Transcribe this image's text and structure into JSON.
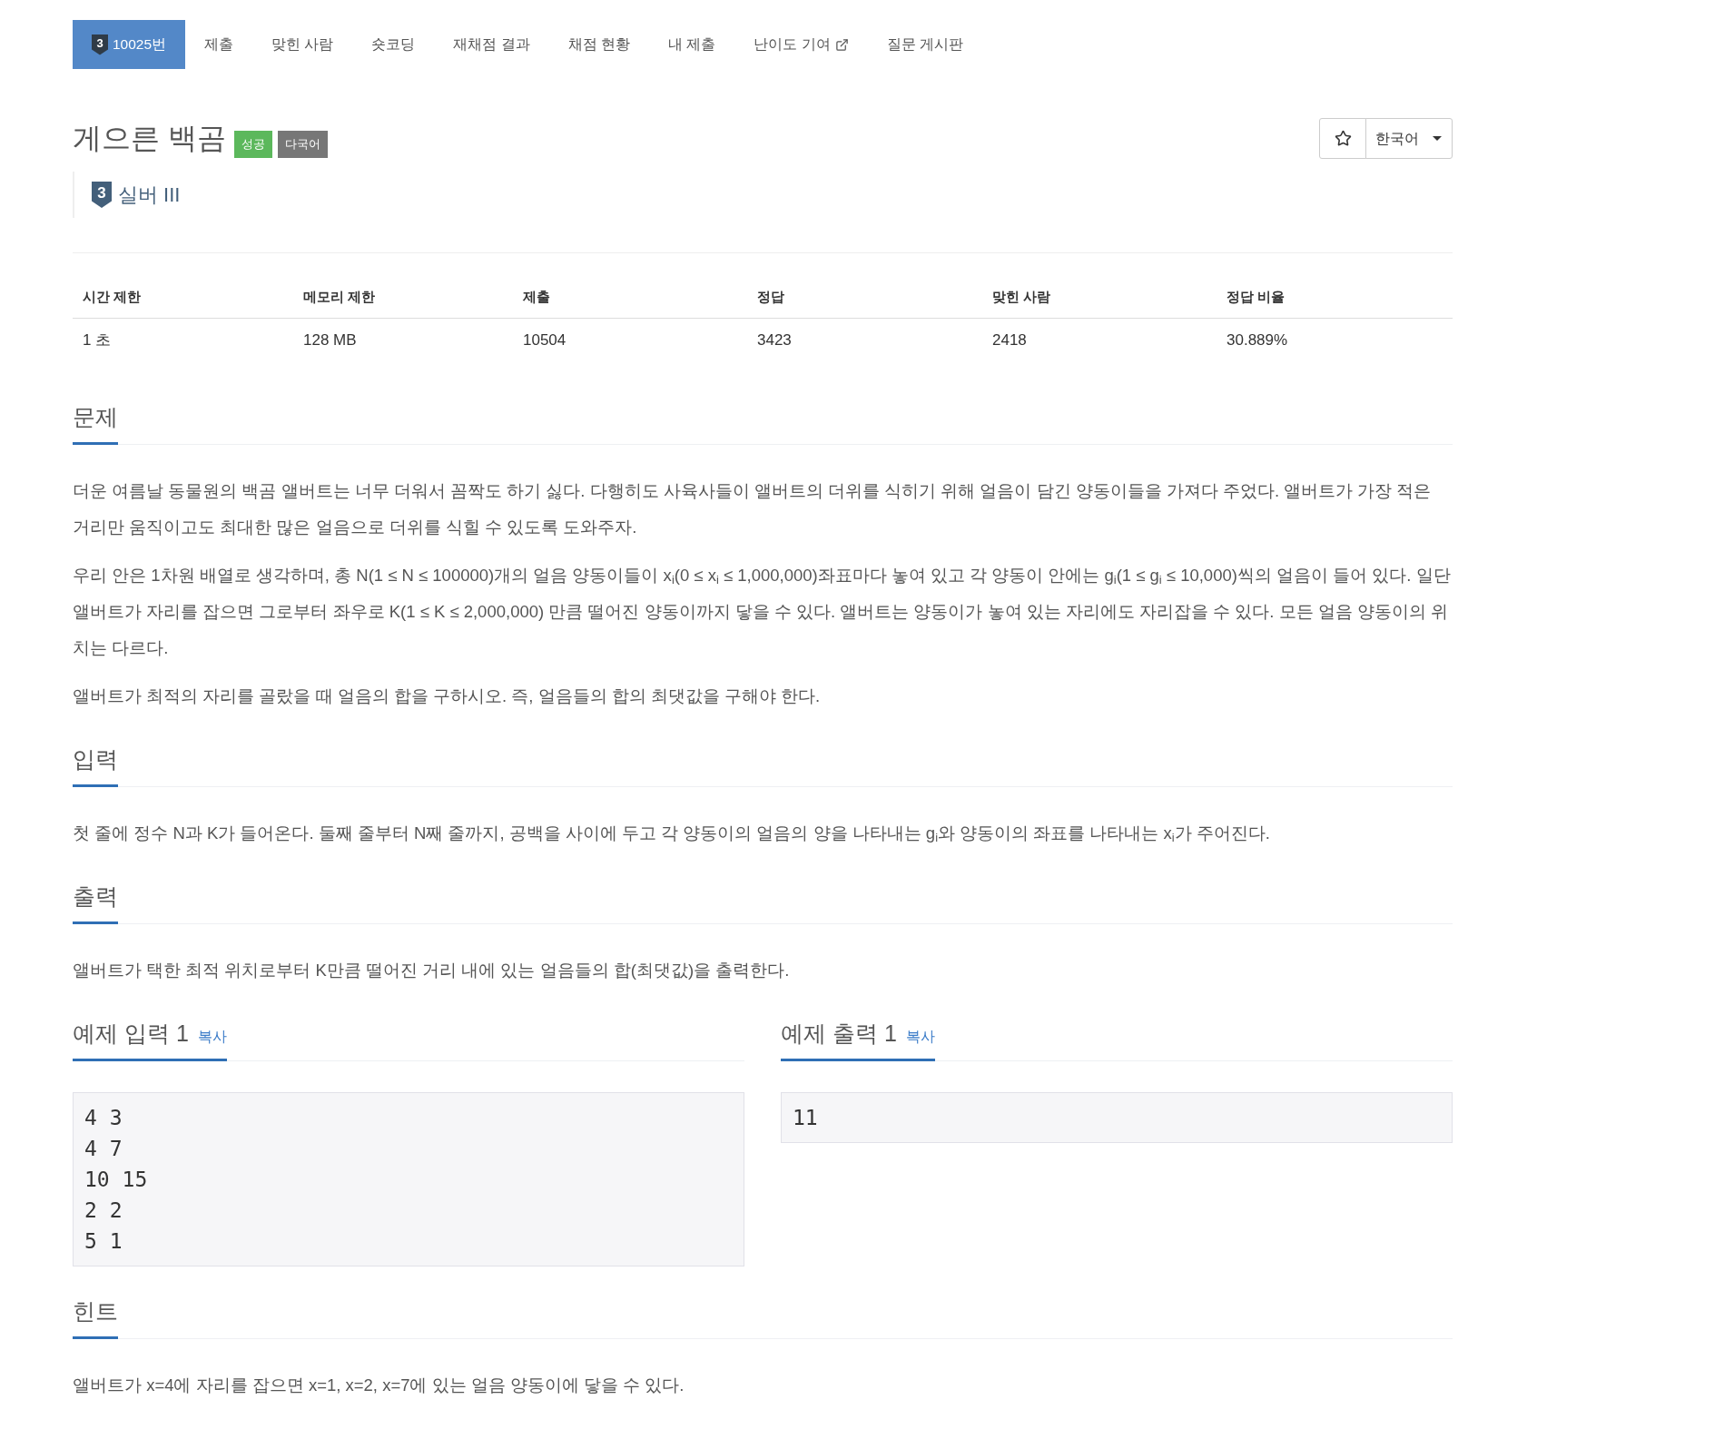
{
  "nav": {
    "tabs": [
      {
        "kind": "problem",
        "tier": "3",
        "label": "10025번",
        "selected": true
      },
      {
        "kind": "link",
        "label": "제출",
        "selected": false
      },
      {
        "kind": "link",
        "label": "맞힌 사람",
        "selected": false
      },
      {
        "kind": "link",
        "label": "숏코딩",
        "selected": false
      },
      {
        "kind": "link",
        "label": "재채점 결과",
        "selected": false
      },
      {
        "kind": "link",
        "label": "채점 현황",
        "selected": false
      },
      {
        "kind": "link",
        "label": "내 제출",
        "selected": false
      },
      {
        "kind": "external",
        "label": "난이도 기여",
        "selected": false
      },
      {
        "kind": "link",
        "label": "질문 게시판",
        "selected": false
      }
    ]
  },
  "problem": {
    "title": "게으른 백곰",
    "badges": [
      {
        "label": "성공",
        "color": "#5cb85c"
      },
      {
        "label": "다국어",
        "color": "#777777"
      }
    ],
    "tier": {
      "number": "3",
      "name": "실버 III"
    }
  },
  "actions": {
    "language": "한국어"
  },
  "stats": {
    "columns": [
      "시간 제한",
      "메모리 제한",
      "제출",
      "정답",
      "맞힌 사람",
      "정답 비율"
    ],
    "rows": [
      [
        "1 초",
        "128 MB",
        "10504",
        "3423",
        "2418",
        "30.889%"
      ]
    ]
  },
  "sections": [
    {
      "kind": "text",
      "title": "문제",
      "paragraphs": [
        "더운 여름날 동물원의 백곰 앨버트는 너무 더워서 꼼짝도 하기 싫다. 다행히도 사육사들이 앨버트의 더위를 식히기 위해 얼음이 담긴 양동이들을 가져다 주었다. 앨버트가 가장 적은 거리만 움직이고도 최대한 많은 얼음으로 더위를 식힐 수 있도록 도와주자.",
        "우리 안은 1차원 배열로 생각하며, 총 N(1 ≤ N ≤ 100000)개의 얼음 양동이들이 x$_{i}$(0 ≤ x$_{i}$ ≤ 1,000,000)좌표마다 놓여 있고 각 양동이 안에는 g$_{i}$(1 ≤ g$_{i}$ ≤ 10,000)씩의 얼음이 들어 있다. 일단 앨버트가 자리를 잡으면 그로부터 좌우로 K(1 ≤ K ≤ 2,000,000) 만큼 떨어진 양동이까지 닿을 수 있다. 앨버트는 양동이가 놓여 있는 자리에도 자리잡을 수 있다. 모든 얼음 양동이의 위치는 다르다.",
        "앨버트가 최적의 자리를 골랐을 때 얼음의 합을 구하시오. 즉, 얼음들의 합의 최댓값을 구해야 한다."
      ]
    },
    {
      "kind": "text",
      "title": "입력",
      "paragraphs": [
        "첫 줄에 정수 N과 K가 들어온다. 둘째 줄부터 N째 줄까지, 공백을 사이에 두고 각 양동이의 얼음의 양을 나타내는 g$_{i}$와 양동이의 좌표를 나타내는 x$_{i}$가 주어진다."
      ]
    },
    {
      "kind": "text",
      "title": "출력",
      "paragraphs": [
        "앨버트가 택한 최적 위치로부터 K만큼 떨어진 거리 내에 있는 얼음들의 합(최댓값)을 출력한다."
      ]
    },
    {
      "kind": "samples",
      "samples": [
        {
          "title": "예제 입력 1",
          "copy": "복사",
          "lines": [
            "4 3",
            "4 7",
            "10 15",
            "2 2",
            "5 1"
          ]
        },
        {
          "title": "예제 출력 1",
          "copy": "복사",
          "lines": [
            "11"
          ]
        }
      ]
    },
    {
      "kind": "text",
      "title": "힌트",
      "paragraphs": [
        "앨버트가 x=4에 자리를 잡으면 x=1, x=2, x=7에 있는 얼음 양동이에 닿을 수 있다."
      ]
    }
  ]
}
